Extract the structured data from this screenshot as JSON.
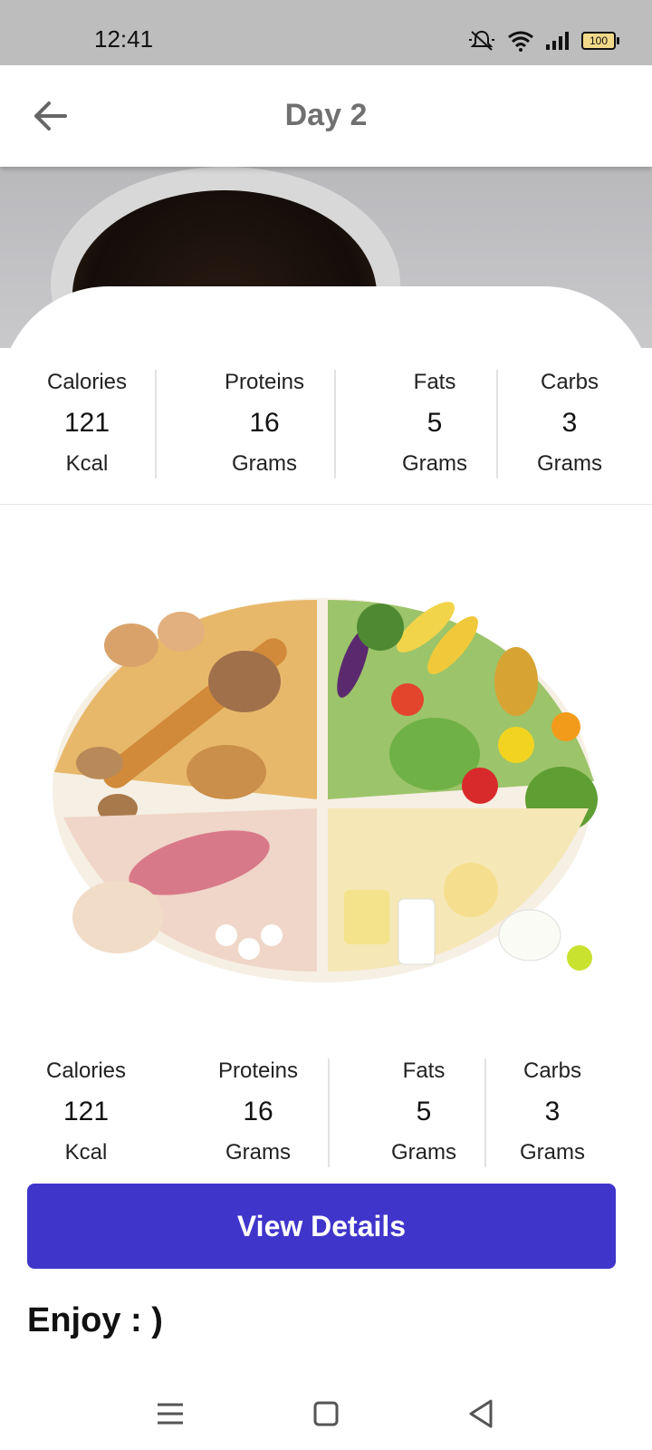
{
  "status_bar": {
    "time": "12:41",
    "battery": "100"
  },
  "app_bar": {
    "title": "Day 2"
  },
  "summary_top": [
    {
      "label": "Calories",
      "value": "121",
      "unit": "Kcal"
    },
    {
      "label": "Proteins",
      "value": "16",
      "unit": "Grams"
    },
    {
      "label": "Fats",
      "value": "5",
      "unit": "Grams"
    },
    {
      "label": "Carbs",
      "value": "3",
      "unit": "Grams"
    }
  ],
  "summary_meal": [
    {
      "label": "Calories",
      "value": "121",
      "unit": "Kcal"
    },
    {
      "label": "Proteins",
      "value": "16",
      "unit": "Grams"
    },
    {
      "label": "Fats",
      "value": "5",
      "unit": "Grams"
    },
    {
      "label": "Carbs",
      "value": "3",
      "unit": "Grams"
    }
  ],
  "actions": {
    "view_details": "View Details"
  },
  "footer": {
    "enjoy_text": "Enjoy : )"
  },
  "colors": {
    "accent": "#4035cb",
    "status_bar": "#bdbdbd"
  }
}
